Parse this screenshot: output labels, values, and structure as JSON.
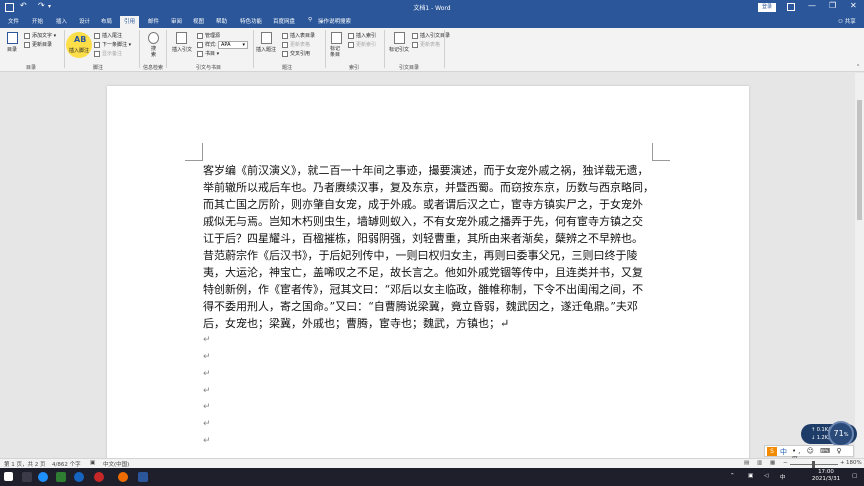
{
  "titlebar": {
    "doc_title": "文档1 - Word",
    "login": "登录"
  },
  "tabs": [
    "文件",
    "开始",
    "插入",
    "设计",
    "布局",
    "引用",
    "邮件",
    "审阅",
    "视图",
    "帮助",
    "特色功能",
    "百度网盘"
  ],
  "active_tab": "引用",
  "tell_me": "操作说明搜索",
  "share": "共享",
  "ribbon": {
    "toc": {
      "big": "目录",
      "add_text": "添加文字",
      "update_toc": "更新目录",
      "group": "目录"
    },
    "footnotes": {
      "insert_footnote": "插入脚注",
      "insert_endnote": "插入尾注",
      "next_footnote": "下一条脚注",
      "show_notes": "显示备注",
      "group": "脚注"
    },
    "research": {
      "big": "搜索",
      "group": "信息检索"
    },
    "citations": {
      "insert_citation": "插入引文",
      "manage_sources": "管理源",
      "style_label": "样式:",
      "style_value": "APA",
      "bibliography": "书目",
      "group": "引文与书目"
    },
    "captions": {
      "insert_caption": "插入题注",
      "insert_table_of_figures": "插入表目录",
      "update_table": "更新表格",
      "cross_reference": "交叉引用",
      "group": "题注"
    },
    "index": {
      "mark_entry": "标记条目",
      "insert_index": "插入索引",
      "update_index": "更新索引",
      "group": "索引"
    },
    "authorities": {
      "mark_citation": "标记引文",
      "insert_toa": "插入引文目录",
      "update_toa": "更新表格",
      "group": "引文目录"
    }
  },
  "document": {
    "lines": [
      "客岁编《前汉演义》，就二百一十年间之事迹，撮要演述，而于女宠外戚之祸，独详载无遗，",
      "举前辙所以戒后车也。乃者赓续汉事，复及东京，并暨西蜀。而窃按东京，历数与西京略同，",
      "而其亡国之厉阶，则亦肇自女宠，成于外戚。或者谓后汉之亡，宦寺方镇实尸之，于女宠外",
      "戚似无与焉。岂知木朽则虫生，墙罅则蚁入，不有女宠外戚之播弄于先，何有宦寺方镇之交",
      "讧于后？四星耀斗，百楹摧栋，阳弱阴强，刘轻曹重，其所由来者渐矣，蘖辨之不早辨也。",
      "昔范蔚宗作《后汉书》，于后妃列传中，一则曰权归女主，再则曰委事父兄，三则曰终于陵",
      "夷，大运沦，神宝亡，盖唏叹之不足，故长言之。他如外戚党锢等传中，且连类并书，又复",
      "特创新例，作《宦者传》，冠其文曰：“邓后以女主临政，雒帷称制，下令不出闺闱之间，不",
      "得不委用刑人，寄之国命。”又曰：“自曹腾说梁冀，竟立昏弱，魏武因之，遂迁龟鼎。”夫邓",
      "后，女宠也；梁冀，外戚也；曹腾，宦寺也；魏武，方镇也；↵"
    ]
  },
  "statusbar": {
    "page": "第 1 页，共 2 页",
    "words": "4/862 个字",
    "lang": "中文(中国)",
    "zoom": "180%"
  },
  "network_widget": {
    "up": "0.1K/s",
    "down": "1.2K/s",
    "percent": "71",
    "percent_unit": "%"
  },
  "ime": {
    "zh": "中",
    "rest": "•, ☺ ⌨ ♀ ⊞"
  },
  "taskbar": {
    "time": "17:00",
    "date": "2021/3/31"
  },
  "colors": {
    "word_blue": "#2b579a",
    "taskbar": "#1f1f2b"
  }
}
